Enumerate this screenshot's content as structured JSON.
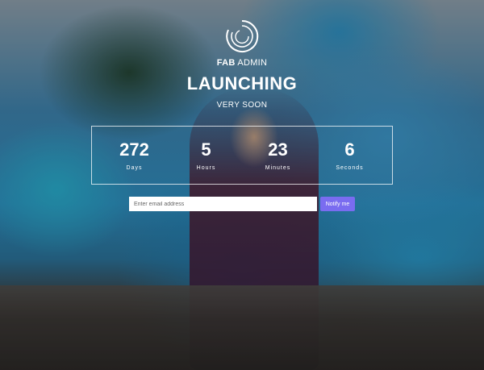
{
  "brand": {
    "strong": "FAB",
    "rest": " ADMIN",
    "logo_icon": "swirl-logo-icon"
  },
  "hero": {
    "title": "LAUNCHING",
    "subtitle": "VERY SOON"
  },
  "countdown": [
    {
      "value": "272",
      "label": "Days"
    },
    {
      "value": "5",
      "label": "Hours"
    },
    {
      "value": "23",
      "label": "Minutes"
    },
    {
      "value": "6",
      "label": "Seconds"
    }
  ],
  "subscribe": {
    "placeholder": "Enter email address",
    "button_label": "Notify me",
    "button_color": "#7a6cf0"
  }
}
